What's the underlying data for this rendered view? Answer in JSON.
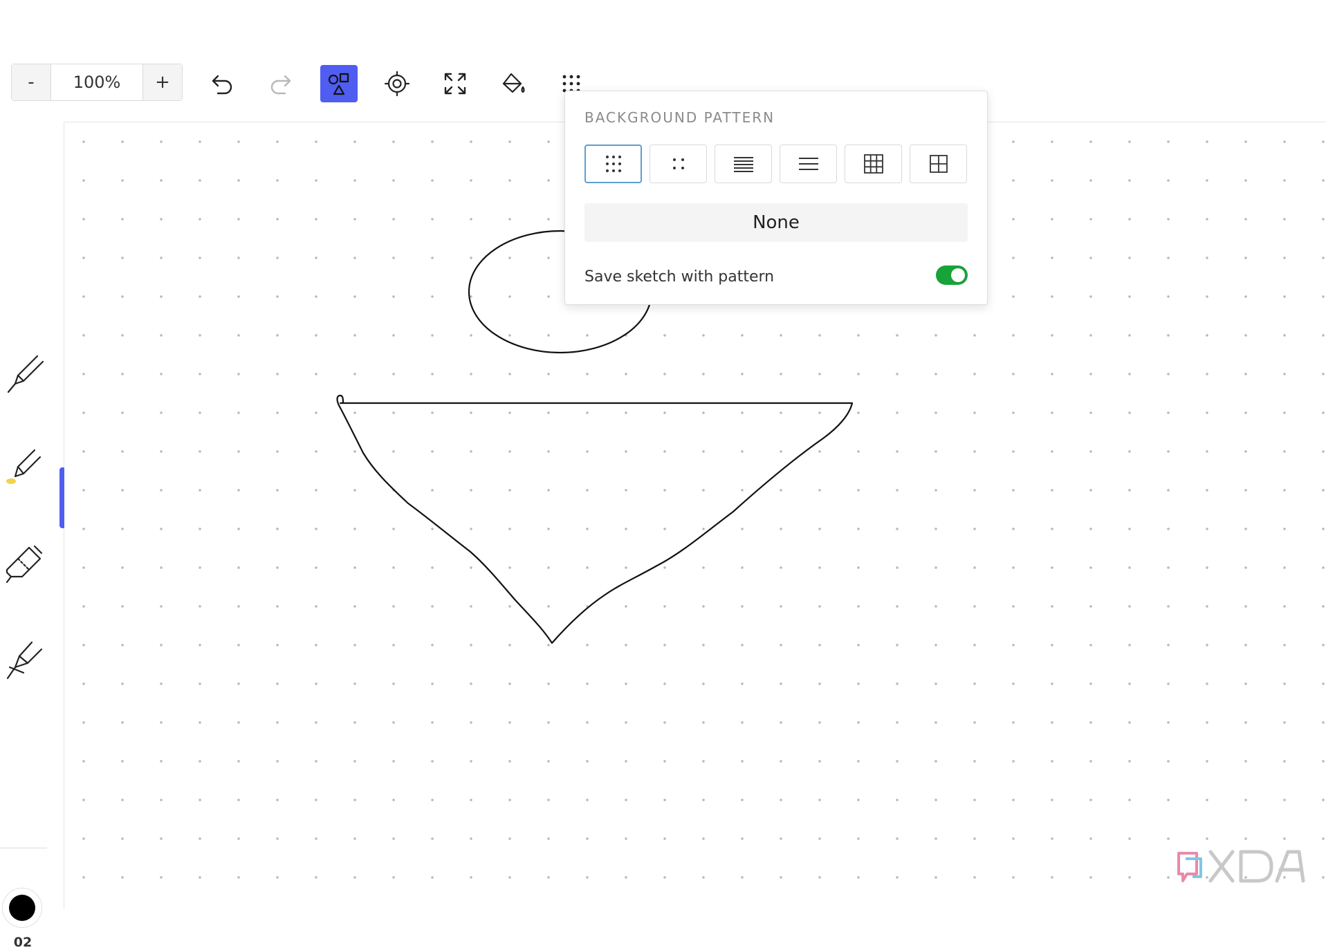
{
  "toolbar": {
    "zoom_out_label": "-",
    "zoom_level": "100%",
    "zoom_in_label": "+",
    "tools": [
      {
        "name": "undo-icon"
      },
      {
        "name": "redo-icon"
      },
      {
        "name": "shapes-icon",
        "active": true
      },
      {
        "name": "crosshair-icon"
      },
      {
        "name": "fullscreen-icon"
      },
      {
        "name": "fill-bucket-icon"
      },
      {
        "name": "dot-grid-icon"
      }
    ],
    "accent_color": "#4f5df1"
  },
  "left_rail": {
    "pens": [
      "pen-icon",
      "highlighter-icon",
      "eraser-icon",
      "calligraphy-pen-icon"
    ],
    "color": "#000000",
    "stroke_size": "02"
  },
  "popover": {
    "title": "BACKGROUND PATTERN",
    "patterns": [
      "dense-dots-icon",
      "sparse-dots-icon",
      "dense-lines-icon",
      "sparse-lines-icon",
      "dense-grid-icon",
      "sparse-grid-icon"
    ],
    "selected_pattern": "dense-dots-icon",
    "none_label": "None",
    "save_label": "Save sketch with pattern",
    "save_enabled": true,
    "toggle_color": "#17a33a"
  },
  "watermark": {
    "text": "XDA"
  }
}
